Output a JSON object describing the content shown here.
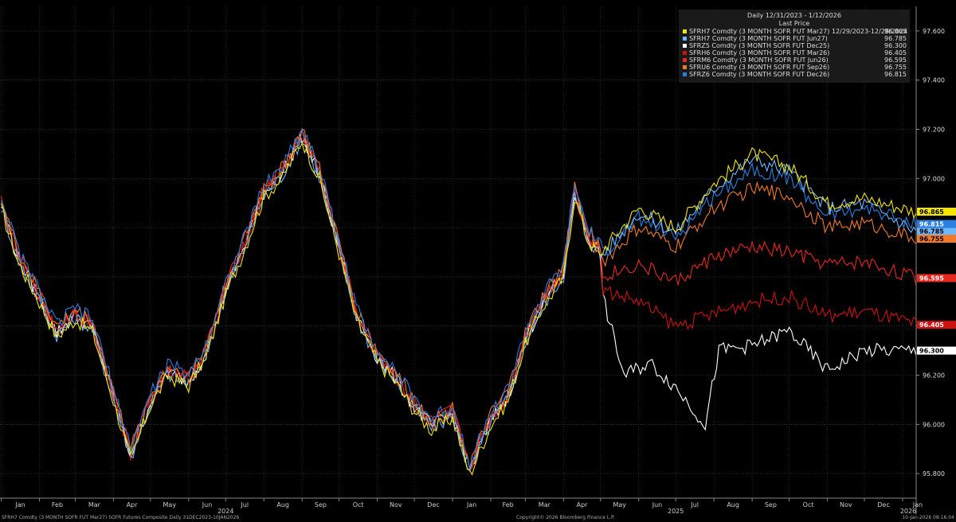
{
  "chart_data": {
    "type": "line",
    "legend": {
      "title": "Daily 12/31/2023 - 1/12/2026",
      "subtitle": "Last Price",
      "placement": "top-right"
    },
    "y_axis": {
      "side": "right",
      "ylim": [
        95.7,
        97.7
      ],
      "ticks": [
        "95.800",
        "96.000",
        "96.200",
        "96.400",
        "96.600",
        "96.800",
        "97.000",
        "97.200",
        "97.400",
        "97.600"
      ],
      "tick_values": [
        95.8,
        96.0,
        96.2,
        96.4,
        96.6,
        96.8,
        97.0,
        97.2,
        97.4,
        97.6
      ],
      "grid": true
    },
    "x_axis": {
      "month_labels": [
        "Jan",
        "Feb",
        "Mar",
        "Apr",
        "May",
        "Jun",
        "Jul",
        "Aug",
        "Sep",
        "Oct",
        "Nov",
        "Dec",
        "Jan",
        "Feb",
        "Mar",
        "Apr",
        "May",
        "Jun",
        "Jul",
        "Aug",
        "Sep",
        "Oct",
        "Nov",
        "Dec",
        "Jan"
      ],
      "year_labels": [
        "2024",
        "2025",
        "2026"
      ],
      "range": [
        "2023-12-31",
        "2026-01-12"
      ],
      "grid": true
    },
    "common_path": {
      "dates": [
        "2024-01-01",
        "2024-01-15",
        "2024-02-01",
        "2024-02-15",
        "2024-03-01",
        "2024-03-15",
        "2024-04-01",
        "2024-04-15",
        "2024-05-01",
        "2024-05-15",
        "2024-06-01",
        "2024-06-15",
        "2024-07-01",
        "2024-07-15",
        "2024-08-01",
        "2024-08-15",
        "2024-09-01",
        "2024-09-15",
        "2024-10-01",
        "2024-10-15",
        "2024-11-01",
        "2024-11-15",
        "2024-12-01",
        "2024-12-15",
        "2025-01-01",
        "2025-01-15",
        "2025-02-01",
        "2025-02-15",
        "2025-03-01",
        "2025-03-15",
        "2025-04-01",
        "2025-04-10",
        "2025-04-20",
        "2025-05-01"
      ],
      "values": [
        96.9,
        96.68,
        96.52,
        96.38,
        96.45,
        96.4,
        96.12,
        95.88,
        96.1,
        96.22,
        96.18,
        96.3,
        96.55,
        96.72,
        96.95,
        97.02,
        97.18,
        97.02,
        96.72,
        96.45,
        96.28,
        96.2,
        96.08,
        96.0,
        96.05,
        95.82,
        96.02,
        96.12,
        96.35,
        96.5,
        96.62,
        96.95,
        96.78,
        96.7
      ]
    },
    "series": [
      {
        "name": "SFRH7 Comdty (3 MONTH SOFR FUT  Mar27) 12/29/2023-12/28/2024",
        "last": "96.865",
        "last_value": 96.865,
        "color": "#f5e600",
        "path": [
          [
            "2025-05-01",
            96.7
          ],
          [
            "2025-06-01",
            96.88
          ],
          [
            "2025-07-01",
            96.8
          ],
          [
            "2025-08-01",
            96.98
          ],
          [
            "2025-09-01",
            97.1
          ],
          [
            "2025-10-01",
            97.05
          ],
          [
            "2025-11-01",
            96.9
          ],
          [
            "2025-12-01",
            96.92
          ],
          [
            "2026-01-12",
            96.865
          ]
        ]
      },
      {
        "name": "SFRH7 Comdty (3 MONTH SOFR FUT  Jun27)",
        "last": "96.785",
        "last_value": 96.785,
        "color": "#6fb7ff",
        "path": [
          [
            "2025-05-01",
            96.68
          ],
          [
            "2025-06-01",
            96.86
          ],
          [
            "2025-07-01",
            96.78
          ],
          [
            "2025-08-01",
            96.96
          ],
          [
            "2025-09-01",
            97.08
          ],
          [
            "2025-10-01",
            97.03
          ],
          [
            "2025-11-01",
            96.88
          ],
          [
            "2025-12-01",
            96.9
          ],
          [
            "2026-01-12",
            96.785
          ]
        ]
      },
      {
        "name": "SFRZ5 Comdty (3 MONTH SOFR FUT  Dec25)",
        "last": "96.300",
        "last_value": 96.3,
        "color": "#ffffff",
        "path": [
          [
            "2025-05-01",
            96.55
          ],
          [
            "2025-05-20",
            96.2
          ],
          [
            "2025-06-10",
            96.25
          ],
          [
            "2025-07-01",
            96.15
          ],
          [
            "2025-07-25",
            96.0
          ],
          [
            "2025-08-05",
            96.3
          ],
          [
            "2025-09-01",
            96.32
          ],
          [
            "2025-10-01",
            96.38
          ],
          [
            "2025-11-01",
            96.22
          ],
          [
            "2025-12-01",
            96.3
          ],
          [
            "2026-01-12",
            96.3
          ]
        ]
      },
      {
        "name": "SFRH6 Comdty (3 MONTH SOFR FUT  Mar26)",
        "last": "96.405",
        "last_value": 96.405,
        "color": "#cc1111",
        "path": [
          [
            "2025-05-01",
            96.55
          ],
          [
            "2025-06-01",
            96.5
          ],
          [
            "2025-07-01",
            96.4
          ],
          [
            "2025-08-01",
            96.45
          ],
          [
            "2025-09-01",
            96.5
          ],
          [
            "2025-10-01",
            96.52
          ],
          [
            "2025-11-01",
            96.44
          ],
          [
            "2025-12-01",
            96.46
          ],
          [
            "2026-01-12",
            96.405
          ]
        ]
      },
      {
        "name": "SFRM6 Comdty (3 MONTH SOFR FUT  Jun26)",
        "last": "96.595",
        "last_value": 96.595,
        "color": "#e8281e",
        "path": [
          [
            "2025-05-01",
            96.6
          ],
          [
            "2025-06-01",
            96.65
          ],
          [
            "2025-07-01",
            96.58
          ],
          [
            "2025-08-01",
            96.68
          ],
          [
            "2025-09-01",
            96.72
          ],
          [
            "2025-10-01",
            96.7
          ],
          [
            "2025-11-01",
            96.65
          ],
          [
            "2025-12-01",
            96.66
          ],
          [
            "2026-01-12",
            96.595
          ]
        ]
      },
      {
        "name": "SFRU6 Comdty (3 MONTH SOFR FUT  Sep26)",
        "last": "96.755",
        "last_value": 96.755,
        "color": "#f07a2a",
        "path": [
          [
            "2025-05-01",
            96.65
          ],
          [
            "2025-06-01",
            96.8
          ],
          [
            "2025-07-01",
            96.72
          ],
          [
            "2025-08-01",
            96.88
          ],
          [
            "2025-09-01",
            96.96
          ],
          [
            "2025-10-01",
            96.93
          ],
          [
            "2025-11-01",
            96.8
          ],
          [
            "2025-12-01",
            96.82
          ],
          [
            "2026-01-12",
            96.755
          ]
        ]
      },
      {
        "name": "SFRZ6 Comdty (3 MONTH SOFR FUT  Dec26)",
        "last": "96.815",
        "last_value": 96.815,
        "color": "#2a7fe0",
        "path": [
          [
            "2025-05-01",
            96.68
          ],
          [
            "2025-06-01",
            96.84
          ],
          [
            "2025-07-01",
            96.76
          ],
          [
            "2025-08-01",
            96.93
          ],
          [
            "2025-09-01",
            97.04
          ],
          [
            "2025-10-01",
            97.0
          ],
          [
            "2025-11-01",
            96.85
          ],
          [
            "2025-12-01",
            96.88
          ],
          [
            "2026-01-12",
            96.815
          ]
        ]
      }
    ]
  },
  "footer": {
    "left": "SFRH7 Comdty (3 MONTH SOFR FUT  Mar27) SOFR Futures Composite Daily 31DEC2023-10JAN2026",
    "center": "Copyright© 2026 Bloomberg Finance L.P.",
    "right": "10-Jan-2026 08:16:04"
  }
}
